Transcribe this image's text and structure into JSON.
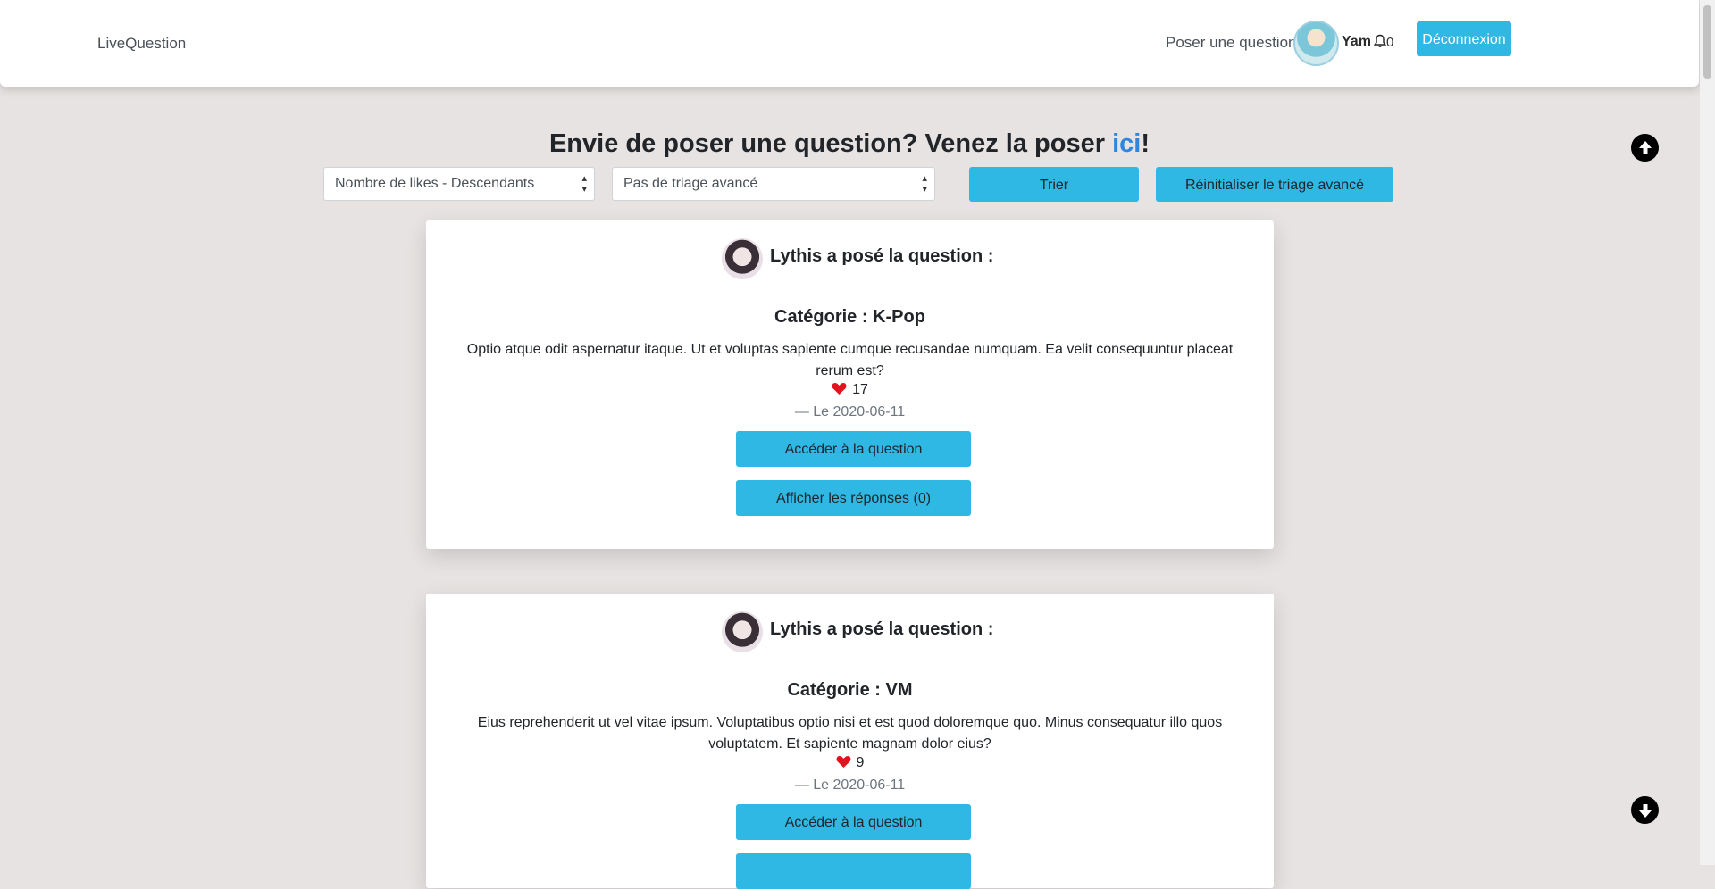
{
  "nav": {
    "brand": "LiveQuestion",
    "ask_link": "Poser une question",
    "username": "Yam",
    "notifications": "0",
    "logout": "Déconnexion"
  },
  "heading": {
    "prefix": "Envie de poser une question? Venez la poser ",
    "link": "ici",
    "suffix": "!"
  },
  "filters": {
    "sort_selected": "Nombre de likes - Descendants",
    "advanced_selected": "Pas de triage avancé",
    "sort_button": "Trier",
    "reset_button": "Réinitialiser le triage avancé"
  },
  "questions": [
    {
      "author": "Lythis",
      "asked_label": " a posé la question :",
      "category": "Catégorie : K-Pop",
      "text": "Optio atque odit aspernatur itaque. Ut et voluptas sapiente cumque recusandae numquam. Ea velit consequuntur placeat rerum est?",
      "likes": "17",
      "date": "— Le 2020-06-11",
      "access_button": "Accéder à la question",
      "answers_button": "Afficher les réponses (0)"
    },
    {
      "author": "Lythis",
      "asked_label": " a posé la question :",
      "category": "Catégorie : VM",
      "text": "Eius reprehenderit ut vel vitae ipsum. Voluptatibus optio nisi et est quod doloremque quo. Minus consequatur illo quos voluptatem. Et sapiente magnam dolor eius?",
      "likes": "9",
      "date": "— Le 2020-06-11",
      "access_button": "Accéder à la question",
      "answers_button": ""
    }
  ],
  "icons": {
    "scroll_up": "arrow-up-circle-icon",
    "scroll_down": "arrow-down-circle-icon",
    "bell": "bell-icon",
    "heart": "heart-icon"
  },
  "colors": {
    "background": "#e7e3e2",
    "accent_button": "#2fb8e3",
    "link": "#2e86de",
    "heart": "#e0141e"
  }
}
